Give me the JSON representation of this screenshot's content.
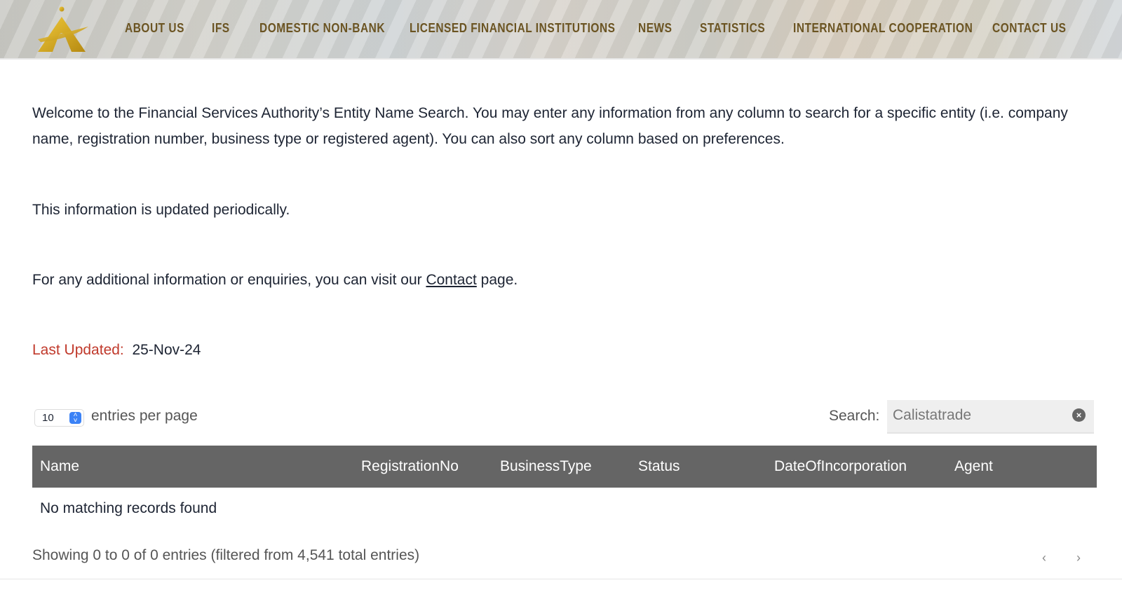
{
  "nav": {
    "items": [
      "ABOUT US",
      "IFS",
      "DOMESTIC NON-BANK",
      "LICENSED FINANCIAL INSTITUTIONS",
      "NEWS",
      "STATISTICS",
      "INTERNATIONAL COOPERATION",
      "CONTACT US"
    ],
    "color": "#6b5422"
  },
  "intro": {
    "p1": "Welcome to the Financial Services Authority’s Entity Name Search. You may enter any information from any column to search for a specific entity (i.e. company name, registration number, business type or registered agent). You can also sort any column based on preferences.",
    "p2": "This information is updated periodically.",
    "p3_before": "For any additional information or enquiries, you can visit our ",
    "p3_link": "Contact",
    "p3_after": " page.",
    "last_updated_label": "Last Updated:",
    "last_updated_value": "25-Nov-24"
  },
  "table": {
    "page_size": "10",
    "entries_label": "entries per page",
    "search_label": "Search:",
    "search_value": "Calistatrade",
    "columns": [
      "Name",
      "RegistrationNo",
      "BusinessType",
      "Status",
      "DateOfIncorporation",
      "Agent"
    ],
    "empty_message": "No matching records found",
    "info": "Showing 0 to 0 of 0 entries (filtered from 4,541 total entries)",
    "prev": "‹",
    "next": "›"
  }
}
